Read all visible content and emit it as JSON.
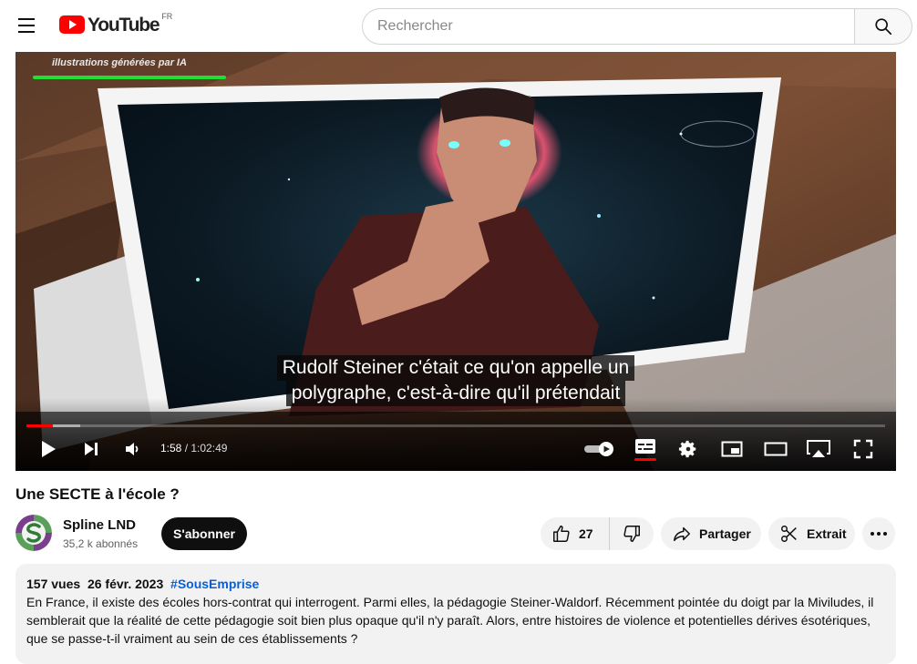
{
  "header": {
    "logo_text": "YouTube",
    "country_code": "FR",
    "search_placeholder": "Rechercher"
  },
  "player": {
    "watermark": "illustrations générées par IA",
    "subtitle_lines": [
      "Rudolf Steiner c'était ce qu'on appelle un",
      "polygraphe, c'est-à-dire qu'il prétendait"
    ],
    "current_time": "1:58",
    "time_separator": " / ",
    "duration": "1:02:49",
    "progress_played_fraction": 0.031,
    "progress_loaded_fraction": 0.063,
    "autoplay_on": true,
    "captions_on": true
  },
  "video": {
    "title": "Une SECTE à l'école ?"
  },
  "channel": {
    "name": "Spline LND",
    "subscribers": "35,2 k abonnés",
    "subscribe_label": "S'abonner"
  },
  "actions": {
    "like_count": "27",
    "share_label": "Partager",
    "clip_label": "Extrait"
  },
  "description": {
    "views": "157 vues",
    "date": "26 févr. 2023",
    "hashtag": "#SousEmprise",
    "text": "En France, il existe des écoles hors-contrat qui interrogent. Parmi elles, la pédagogie Steiner-Waldorf. Récemment pointée du doigt par la Miviludes, il semblerait que la réalité de cette pédagogie soit bien plus opaque qu'il n'y paraît. Alors, entre histoires de violence et potentielles dérives ésotériques, que se passe-t-il vraiment au sein de ces établissements ?"
  },
  "colors": {
    "brand_red": "#ff0000",
    "link_blue": "#065fd4",
    "watermark_green": "#22dd33"
  }
}
